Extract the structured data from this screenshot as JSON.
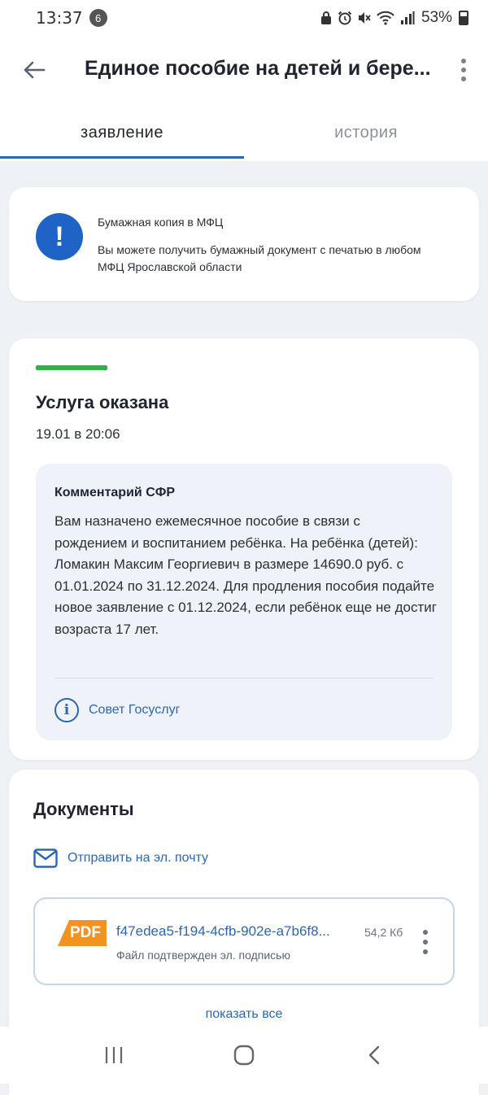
{
  "status_bar": {
    "time": "13:37",
    "notification_count": "6",
    "battery": "53%"
  },
  "header": {
    "title": "Единое пособие на детей и бере..."
  },
  "tabs": [
    {
      "label": "заявление",
      "active": true
    },
    {
      "label": "история",
      "active": false
    }
  ],
  "mfc_notice": {
    "title": "Бумажная копия в МФЦ",
    "text": "Вы можете получить бумажный документ с печатью в любом МФЦ Ярославской области"
  },
  "service_status": {
    "title": "Услуга оказана",
    "date": "19.01 в 20:06",
    "status_color": "#2db34a"
  },
  "comment": {
    "title": "Комментарий СФР",
    "text": "Вам назначено ежемесячное пособие в связи с рождением и воспитанием ребёнка. На ребёнка (детей): Ломакин Максим Георгиевич в размере 14690.0 руб. с 01.01.2024 по 31.12.2024. Для продления пособия подайте новое заявление с 01.12.2024, если ребёнок еще не достиг возраста 17 лет.",
    "tip_label": "Совет Госуслуг"
  },
  "documents": {
    "title": "Документы",
    "email_label": "Отправить на эл. почту",
    "files": [
      {
        "type": "PDF",
        "name": "f47edea5-f194-4cfb-902e-a7b6f8...",
        "size": "54,2 Кб",
        "signature": "Файл подтвержден эл. подписью"
      }
    ],
    "show_all_label": "показать все"
  },
  "colors": {
    "accent": "#2b66b5",
    "alert": "#1f63c6",
    "pdf_badge": "#f39221"
  }
}
